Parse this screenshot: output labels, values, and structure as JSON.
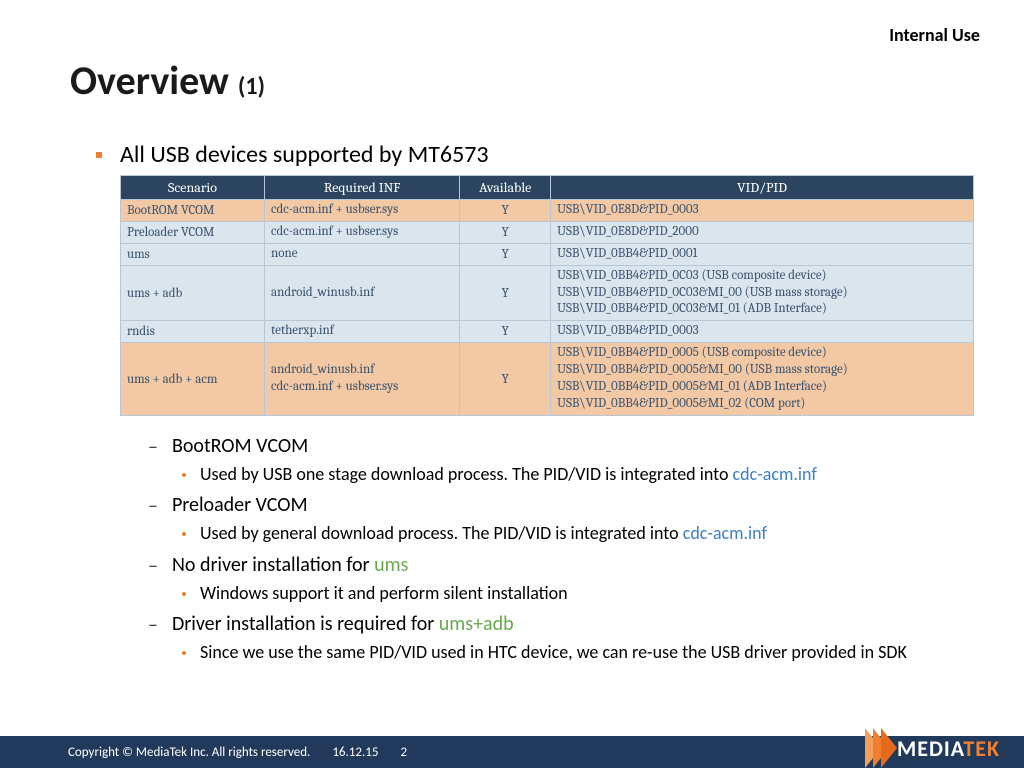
{
  "classification": "Internal Use",
  "title_main": "Overview ",
  "title_sub": "(1)",
  "main_bullet": "All USB devices supported by MT6573",
  "table": {
    "headers": [
      "Scenario",
      "Required INF",
      "Available",
      "VID/PID"
    ],
    "rows": [
      {
        "cls": "orange",
        "scenario": "BootROM VCOM",
        "inf": [
          "cdc-acm.inf + usbser.sys"
        ],
        "avail": "Y",
        "vidpid": [
          "USB\\VID_0E8D&PID_0003"
        ]
      },
      {
        "cls": "blue",
        "scenario": "Preloader VCOM",
        "inf": [
          "cdc-acm.inf + usbser.sys"
        ],
        "avail": "Y",
        "vidpid": [
          "USB\\VID_0E8D&PID_2000"
        ]
      },
      {
        "cls": "blue",
        "scenario": "ums",
        "inf": [
          "none"
        ],
        "avail": "Y",
        "vidpid": [
          "USB\\VID_0BB4&PID_0001"
        ]
      },
      {
        "cls": "blue",
        "scenario": "ums + adb",
        "inf": [
          "android_winusb.inf"
        ],
        "avail": "Y",
        "vidpid": [
          "USB\\VID_0BB4&PID_0C03 (USB composite device)",
          "USB\\VID_0BB4&PID_0C03&MI_00 (USB mass storage)",
          "USB\\VID_0BB4&PID_0C03&MI_01 (ADB Interface)"
        ]
      },
      {
        "cls": "blue",
        "scenario": "rndis",
        "inf": [
          "tetherxp.inf"
        ],
        "avail": "Y",
        "vidpid": [
          "USB\\VID_0BB4&PID_0003"
        ]
      },
      {
        "cls": "orange",
        "scenario": "ums + adb + acm",
        "inf": [
          "android_winusb.inf",
          "cdc-acm.inf + usbser.sys"
        ],
        "avail": "Y",
        "vidpid": [
          "USB\\VID_0BB4&PID_0005 (USB composite device)",
          "USB\\VID_0BB4&PID_0005&MI_00 (USB mass storage)",
          "USB\\VID_0BB4&PID_0005&MI_01 (ADB Interface)",
          "USB\\VID_0BB4&PID_0005&MI_02 (COM port)"
        ]
      }
    ]
  },
  "sublist": [
    {
      "dash": "BootROM VCOM",
      "dots": [
        {
          "parts": [
            {
              "t": "Used by USB one stage download process. The PID/VID is integrated into "
            },
            {
              "t": "cdc-acm.inf",
              "cls": "link-text"
            }
          ]
        }
      ]
    },
    {
      "dash": "Preloader VCOM",
      "dots": [
        {
          "parts": [
            {
              "t": "Used by general download process. The PID/VID is integrated into "
            },
            {
              "t": "cdc-acm.inf",
              "cls": "link-text"
            }
          ]
        }
      ]
    },
    {
      "dash_parts": [
        {
          "t": "No driver installation for "
        },
        {
          "t": "ums",
          "cls": "green-text"
        }
      ],
      "dots": [
        {
          "parts": [
            {
              "t": "Windows support it and perform silent installation"
            }
          ]
        }
      ]
    },
    {
      "dash_parts": [
        {
          "t": "Driver installation is required for "
        },
        {
          "t": "ums+adb",
          "cls": "green-text"
        }
      ],
      "dots": [
        {
          "parts": [
            {
              "t": "Since we use the same PID/VID used in HTC device, we can re-use the USB driver provided in SDK"
            }
          ]
        }
      ]
    }
  ],
  "footer": {
    "copyright": "Copyright © MediaTek Inc. All rights reserved.",
    "date": "16.12.15",
    "page": "2",
    "logo1": "MEDIA",
    "logo2": "TEK"
  }
}
